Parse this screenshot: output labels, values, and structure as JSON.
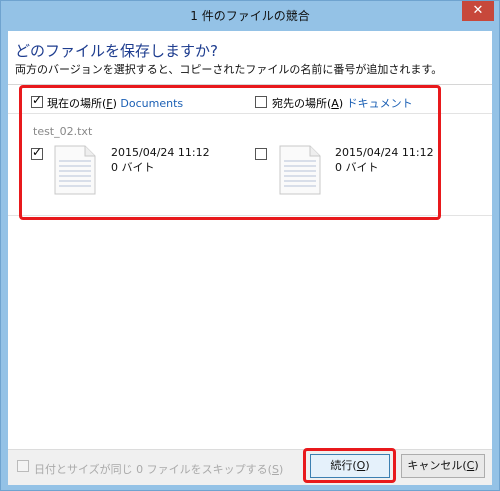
{
  "window": {
    "title": "1 件のファイルの競合",
    "close_glyph": "✕"
  },
  "heading": "どのファイルを保存しますか?",
  "subheading": "両方のバージョンを選択すると、コピーされたファイルの名前に番号が追加されます。",
  "source": {
    "label": "現在の場所(",
    "mnemonic": "F",
    "label_end": ")",
    "location": "Documents",
    "checked": true
  },
  "dest": {
    "label": "宛先の場所(",
    "mnemonic": "A",
    "label_end": ")",
    "location": "ドキュメント",
    "checked": false
  },
  "file": {
    "name": "test_02.txt",
    "source_date": "2015/04/24 11:12",
    "source_size": "0 バイト",
    "dest_date": "2015/04/24 11:12",
    "dest_size": "0 バイト"
  },
  "footer": {
    "skip_label": "日付とサイズが同じ 0 ファイルをスキップする(",
    "skip_mnemonic": "S",
    "skip_end": ")",
    "continue_label": "続行(",
    "continue_mnemonic": "O",
    "continue_end": ")",
    "cancel_label": "キャンセル(",
    "cancel_mnemonic": "C",
    "cancel_end": ")"
  },
  "colors": {
    "title_bar": "#94c2e6",
    "heading": "#1e3d8f",
    "link": "#1a5fb4",
    "highlight": "#e8191c",
    "close_button": "#c7483b"
  }
}
